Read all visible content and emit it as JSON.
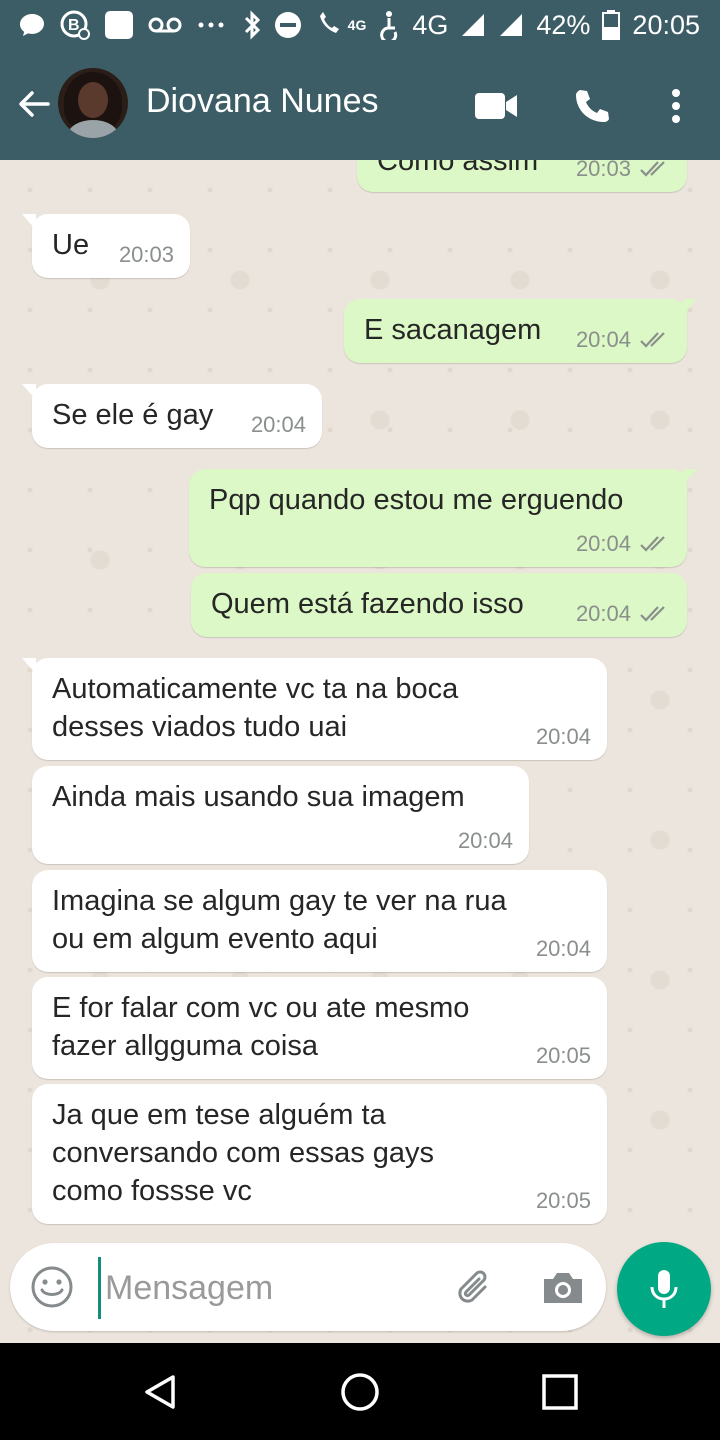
{
  "status_bar": {
    "network": "4G",
    "battery": "42%",
    "time": "20:05",
    "icons": [
      "chat-notification-icon",
      "b-notification-icon",
      "square-notification-icon",
      "voicemail-icon",
      "more-notifications-icon",
      "bluetooth-icon",
      "do-not-disturb-icon",
      "volte-icon",
      "accessibility-icon",
      "signal-icon",
      "signal-icon-2",
      "battery-icon"
    ],
    "volte_label": "4G"
  },
  "header": {
    "contact_name": "Diovana Nunes",
    "icons": [
      "back-arrow-icon",
      "video-call-icon",
      "phone-icon",
      "more-vert-icon"
    ]
  },
  "messages": [
    {
      "dir": "out",
      "text": "Como assim",
      "time": "20:03",
      "read": true
    },
    {
      "dir": "in",
      "text": "Ue",
      "time": "20:03"
    },
    {
      "dir": "out",
      "text": "E sacanagem",
      "time": "20:04",
      "read": true
    },
    {
      "dir": "in",
      "text": "Se ele é gay",
      "time": "20:04"
    },
    {
      "dir": "out",
      "text": "Pqp quando estou me erguendo",
      "time": "20:04",
      "read": true
    },
    {
      "dir": "out",
      "text": "Quem está fazendo isso",
      "time": "20:04",
      "read": true
    },
    {
      "dir": "in",
      "lines": [
        "Automaticamente vc ta na boca",
        "desses viados tudo uai"
      ],
      "time": "20:04"
    },
    {
      "dir": "in",
      "text": "Ainda mais usando sua imagem",
      "time": "20:04"
    },
    {
      "dir": "in",
      "lines": [
        "Imagina se algum gay te ver na rua",
        "ou em algum evento aqui"
      ],
      "time": "20:04"
    },
    {
      "dir": "in",
      "lines": [
        "E for falar com vc ou ate mesmo",
        "fazer allgguma coisa"
      ],
      "time": "20:05"
    },
    {
      "dir": "in",
      "lines": [
        "Ja que em tese alguém ta",
        "conversando com essas gays",
        "como fossse vc"
      ],
      "time": "20:05"
    }
  ],
  "composer": {
    "placeholder": "Mensagem",
    "icons": [
      "emoji-icon",
      "attach-icon",
      "camera-icon",
      "mic-icon"
    ]
  },
  "colors": {
    "header": "#3d5d66",
    "outgoing_bubble": "#dcf8c6",
    "incoming_bubble": "#ffffff",
    "accent": "#00a884",
    "read_ticks": "#8a8f8c"
  },
  "nav_bar": {
    "icons": [
      "back-triangle-icon",
      "home-circle-icon",
      "recents-square-icon"
    ]
  }
}
